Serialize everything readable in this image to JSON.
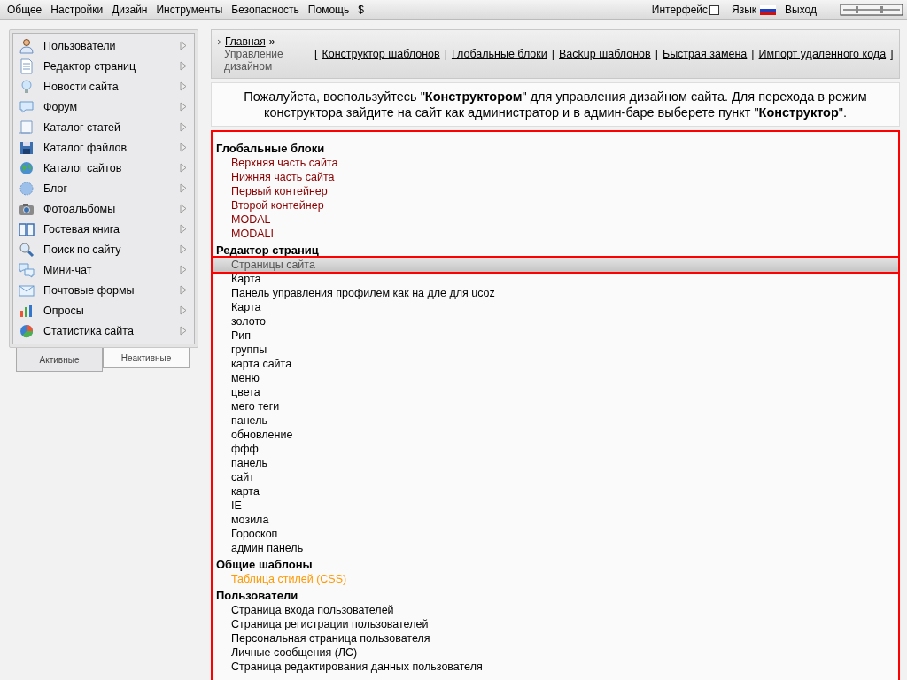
{
  "top_menu": [
    "Общее",
    "Настройки",
    "Дизайн",
    "Инструменты",
    "Безопасность",
    "Помощь",
    "$"
  ],
  "top_right": {
    "interface_label": "Интерфейс",
    "interface_checked": false,
    "language_label": "Язык",
    "logout": "Выход"
  },
  "sidebar": {
    "items": [
      {
        "label": "Пользователи"
      },
      {
        "label": "Редактор страниц"
      },
      {
        "label": "Новости сайта"
      },
      {
        "label": "Форум"
      },
      {
        "label": "Каталог статей"
      },
      {
        "label": "Каталог файлов"
      },
      {
        "label": "Каталог сайтов"
      },
      {
        "label": "Блог"
      },
      {
        "label": "Фотоальбомы"
      },
      {
        "label": "Гостевая книга"
      },
      {
        "label": "Поиск по сайту"
      },
      {
        "label": "Мини-чат"
      },
      {
        "label": "Почтовые формы"
      },
      {
        "label": "Опросы"
      },
      {
        "label": "Статистика сайта"
      }
    ],
    "tabs": [
      {
        "label": "Активные",
        "selected": true
      },
      {
        "label": "Неактивные",
        "selected": false
      }
    ]
  },
  "breadcrumb": {
    "home": "Главная",
    "separator": "»",
    "current": "Управление дизайном"
  },
  "header_links": {
    "open": "[",
    "close": "]",
    "divider": "|",
    "links": [
      "Конструктор шаблонов",
      "Глобальные блоки",
      "Backup шаблонов",
      "Быстрая замена",
      "Импорт удаленного кода"
    ]
  },
  "notice": "Пожалуйста, воспользуйтесь \"**Конструктором**\" для управления дизайном сайта. Для перехода в режим конструктора зайдите на сайт как администратор и в админ-баре выберете пункт \"**Конструктор**\".",
  "groups": [
    {
      "title": "Глобальные блоки",
      "color": "#8b0000",
      "items": [
        {
          "label": "Верхняя часть сайта",
          "selected": false
        },
        {
          "label": "Нижняя часть сайта",
          "selected": false
        },
        {
          "label": "Первый контейнер",
          "selected": false
        },
        {
          "label": "Второй контейнер",
          "selected": false
        },
        {
          "label": "MODAL",
          "selected": false
        },
        {
          "label": "MODALI",
          "selected": false
        }
      ]
    },
    {
      "title": "Редактор страниц",
      "color": "#000000",
      "items": [
        {
          "label": "Страницы сайта",
          "selected": true
        },
        {
          "label": "Карта",
          "selected": false
        },
        {
          "label": "Панель управления профилем как на дле для ucoz",
          "selected": false
        },
        {
          "label": "Карта",
          "selected": false
        },
        {
          "label": "золото",
          "selected": false
        },
        {
          "label": "Рип",
          "selected": false
        },
        {
          "label": "группы",
          "selected": false
        },
        {
          "label": "карта сайта",
          "selected": false
        },
        {
          "label": "меню",
          "selected": false
        },
        {
          "label": "цвета",
          "selected": false
        },
        {
          "label": "мего теги",
          "selected": false
        },
        {
          "label": "панель",
          "selected": false
        },
        {
          "label": "обновление",
          "selected": false
        },
        {
          "label": "ффф",
          "selected": false
        },
        {
          "label": "панель",
          "selected": false
        },
        {
          "label": "сайт",
          "selected": false
        },
        {
          "label": "карта",
          "selected": false
        },
        {
          "label": "IE",
          "selected": false
        },
        {
          "label": "мозила",
          "selected": false
        },
        {
          "label": "Гороскоп",
          "selected": false
        },
        {
          "label": "админ панель",
          "selected": false
        }
      ]
    },
    {
      "title": "Общие шаблоны",
      "color": "#ff9900",
      "items": [
        {
          "label": "Таблица стилей (CSS)",
          "selected": false
        }
      ]
    },
    {
      "title": "Пользователи",
      "color": "#000000",
      "items": [
        {
          "label": "Страница входа пользователей",
          "selected": false
        },
        {
          "label": "Страница регистрации пользователей",
          "selected": false
        },
        {
          "label": "Персональная страница пользователя",
          "selected": false
        },
        {
          "label": "Личные сообщения (ЛС)",
          "selected": false
        },
        {
          "label": "Страница редактирования данных пользователя",
          "selected": false
        }
      ]
    }
  ]
}
